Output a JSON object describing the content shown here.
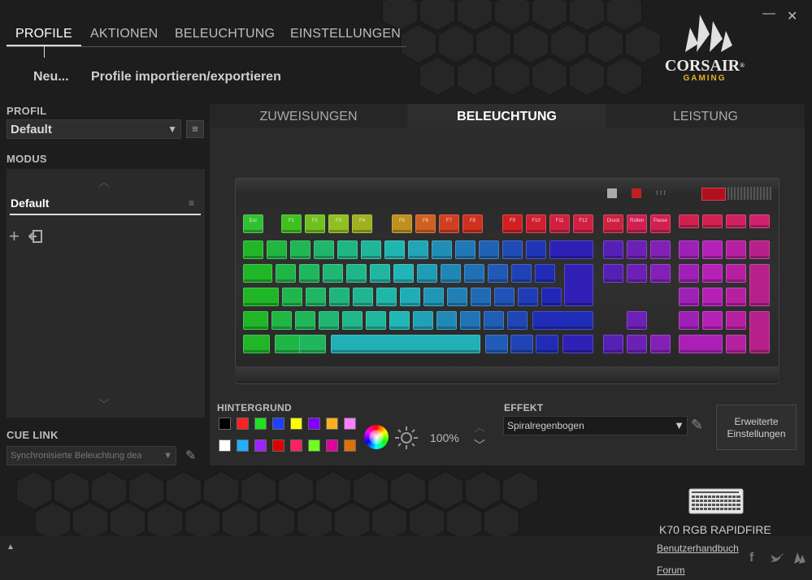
{
  "window": {
    "minimize_label": "—",
    "close_label": "✕"
  },
  "nav": {
    "tabs": [
      "PROFILE",
      "AKTIONEN",
      "BELEUCHTUNG",
      "EINSTELLUNGEN"
    ]
  },
  "profile_actions": {
    "new_label": "Neu...",
    "import_export_label": "Profile importieren/exportieren"
  },
  "brand": {
    "name": "CORSAIR",
    "registered": "®",
    "sub": "GAMING",
    "sub_color": "#e6b325"
  },
  "sidebar": {
    "profile_label": "PROFIL",
    "profile_value": "Default",
    "mode_label": "MODUS",
    "mode_item": "Default",
    "cue_link_label": "CUE LINK",
    "cue_link_value": "Synchronisierte Beleuchtung dea"
  },
  "subtabs": [
    "ZUWEISUNGEN",
    "BELEUCHTUNG",
    "LEISTUNG"
  ],
  "lighting": {
    "background_label": "HINTERGRUND",
    "swatches_row1": [
      "#000000",
      "#ff2020",
      "#20e020",
      "#2040ff",
      "#ffff00",
      "#8000ff",
      "#ffb020",
      "#ff80ff"
    ],
    "swatches_row2": [
      "#ffffff",
      "#20b0ff",
      "#a020ff",
      "#e00000",
      "#ff2060",
      "#70ff20",
      "#e000a0",
      "#e07000"
    ],
    "brightness": "100%",
    "effect_label": "EFFEKT",
    "effect_value": "Spiralregenbogen",
    "advanced_label": "Erweiterte\nEinstellungen"
  },
  "device": {
    "name": "K70 RGB RAPIDFIRE"
  },
  "footer": {
    "manual_link": "Benutzerhandbuch",
    "forum_link": "Forum"
  },
  "keyboard_keys": [
    {
      "l": "Esc",
      "c": "#30c030"
    },
    {
      "l": "F1",
      "c": "#40c020"
    },
    {
      "l": "F2",
      "c": "#70c020"
    },
    {
      "l": "F3",
      "c": "#90c020"
    },
    {
      "l": "F4",
      "c": "#a0b020"
    },
    {
      "l": "F5",
      "c": "#c09020"
    },
    {
      "l": "F6",
      "c": "#d06020"
    },
    {
      "l": "F7",
      "c": "#d04020"
    },
    {
      "l": "F8",
      "c": "#d03020"
    },
    {
      "l": "F9",
      "c": "#d02020"
    },
    {
      "l": "F10",
      "c": "#d02030"
    },
    {
      "l": "F11",
      "c": "#d02040"
    },
    {
      "l": "F12",
      "c": "#d02040"
    },
    {
      "l": "Druck",
      "c": "#d02040"
    },
    {
      "l": "Rollen",
      "c": "#d02050"
    },
    {
      "l": "Pause",
      "c": "#d02050"
    }
  ]
}
